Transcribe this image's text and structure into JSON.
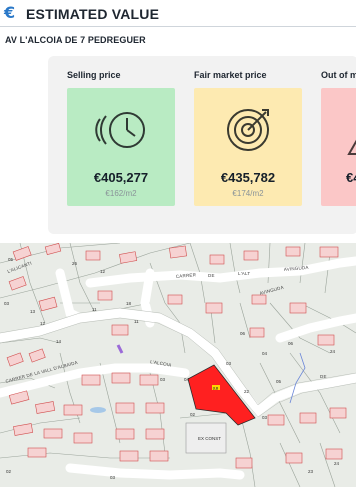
{
  "header": {
    "icon": "euro-icon",
    "title": "ESTIMATED VALUE",
    "accent": "#2a78c8"
  },
  "address": "AV L'ALCOIA DE 7 PEDREGUER",
  "cards": [
    {
      "label": "Selling price",
      "value": "€405,277",
      "per_m2": "€162/m2",
      "icon": "clock-history-icon",
      "color": "#b9ebc3"
    },
    {
      "label": "Fair market price",
      "value": "€435,782",
      "per_m2": "€174/m2",
      "icon": "target-icon",
      "color": "#fdeab1"
    },
    {
      "label": "Out of m",
      "value": "€4",
      "per_m2": "",
      "icon": "warning-icon",
      "color": "#fbc7c7"
    }
  ],
  "map": {
    "streets": [
      "CARRER",
      "DE",
      "L'ALT",
      "AVINGUDA",
      "L'ALICANTI",
      "L'ALCOIA",
      "AVINGUDA",
      "CARRER DE LA VALL D'ALBAIDA",
      "DE"
    ],
    "parcel_label": "3.8",
    "building_label": "EX CONST",
    "numbers": [
      "05",
      "26",
      "12",
      "03",
      "13",
      "12",
      "11",
      "18",
      "11",
      "03",
      "04",
      "03",
      "22",
      "04",
      "06",
      "24",
      "06",
      "05",
      "03",
      "02",
      "02",
      "03",
      "23",
      "24",
      "14"
    ],
    "highlight_color": "#ff2020"
  }
}
